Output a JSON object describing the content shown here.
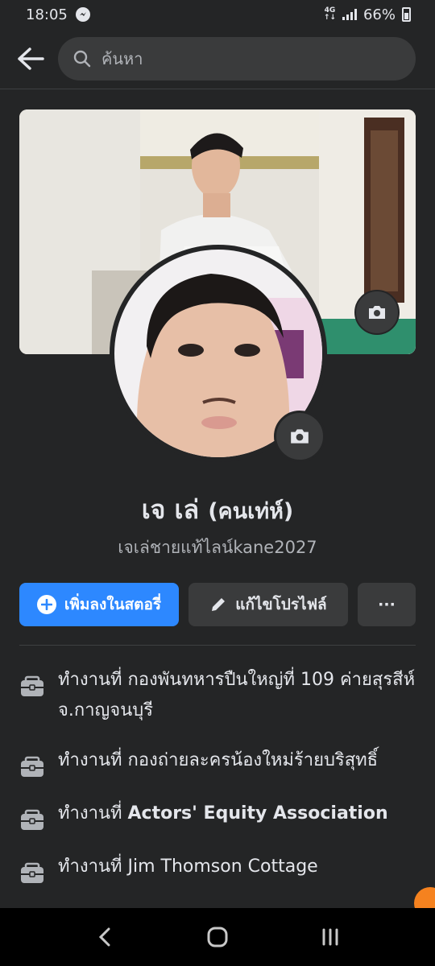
{
  "status_bar": {
    "time": "18:05",
    "network_top": "4G",
    "network_bottom": "↑↓",
    "battery": "66%"
  },
  "search": {
    "placeholder": "ค้นหา"
  },
  "profile": {
    "name": "เจ เล่",
    "nickname": "(คนเท่ห์)",
    "username": "เจเล่ชายแท้ไลน์kane2027"
  },
  "actions": {
    "add_story": "เพิ่มลงในสตอรี่",
    "edit_profile": "แก้ไขโปรไฟล์",
    "more": "···"
  },
  "work": [
    {
      "prefix": "ทำงานที่",
      "place": "กองพันทหารปืนใหญ่ที่ 109 ค่ายสุรสีห์ จ.กาญจนบุรี",
      "bold": false
    },
    {
      "prefix": "ทำงานที่",
      "place": "กองถ่ายละครน้องใหม่ร้ายบริสุทธิ์",
      "bold": false
    },
    {
      "prefix": "ทำงานที่",
      "place": "Actors' Equity Association",
      "bold": true
    },
    {
      "prefix": "ทำงานที่",
      "place": "Jim Thomson Cottage",
      "bold": false
    }
  ],
  "colors": {
    "background": "#242526",
    "primary": "#2d88ff",
    "surface": "#3a3b3c",
    "text": "#e4e6eb",
    "muted": "#b0b3b8"
  },
  "icons": {
    "back": "arrow-left-icon",
    "search": "search-icon",
    "camera": "camera-icon",
    "plus": "plus-circle-icon",
    "edit": "pencil-icon",
    "work": "briefcase-icon"
  }
}
